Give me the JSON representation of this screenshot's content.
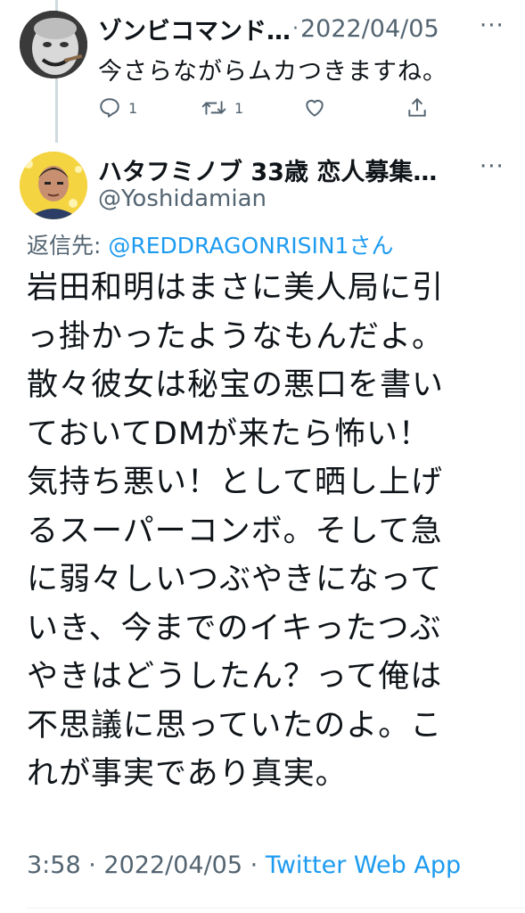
{
  "parent_tweet": {
    "author_name": "ゾンビコマンド…",
    "separator": "·",
    "date": "2022/04/05",
    "more_icon": "more-icon",
    "text": "今さらながらムカつきますね。",
    "actions": {
      "reply_count": "1",
      "retweet_count": "1"
    }
  },
  "main_tweet": {
    "author_name": "ハタフミノブ 33歳 恋人募集…",
    "handle": "@Yoshidamian",
    "more_icon": "more-icon",
    "reply_label": "返信先:",
    "reply_to": "@REDDRAGONRISIN1",
    "reply_suffix": "さん",
    "text": "岩田和明はまさに美人局に引\nっ掛かったようなもんだよ。\n散々彼女は秘宝の悪口を書い\nておいてDMが来たら怖い！\n気持ち悪い！として晒し上げ\nるスーパーコンボ。そして急\nに弱々しいつぶやきになって\nいき、今までのイキったつぶ\nやきはどうしたん？って俺は\n不思議に思っていたのよ。こ\nれが事実であり真実。",
    "time": "3:58",
    "separator": "·",
    "date": "2022/04/05",
    "source": "Twitter Web App"
  }
}
